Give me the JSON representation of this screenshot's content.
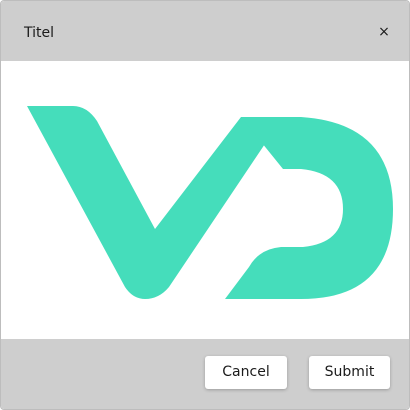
{
  "dialog": {
    "title": "Titel",
    "close_label": "×"
  },
  "logo": {
    "icon": "vd-logo-icon",
    "color": "#45DDBB"
  },
  "footer": {
    "cancel_label": "Cancel",
    "submit_label": "Submit"
  },
  "colors": {
    "header_bg": "#CECECE",
    "footer_bg": "#CECECE",
    "body_bg": "#FFFFFF"
  }
}
